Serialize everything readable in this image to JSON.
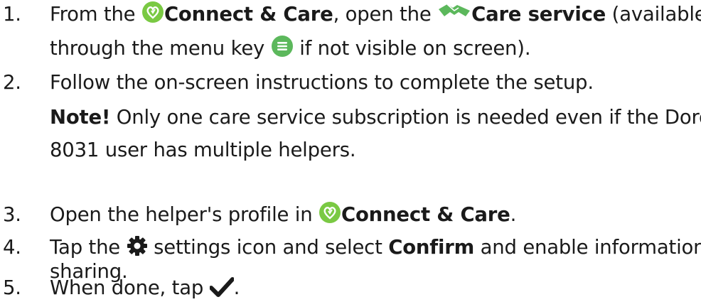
{
  "icons": {
    "connect_care": "heart-icon",
    "care_service": "handshake-icon",
    "menu": "menu-icon",
    "settings": "gear-icon",
    "done": "checkmark-icon",
    "brand_green": "#7ac943",
    "icon_green": "#5cb85c"
  },
  "steps": [
    {
      "num": "1.",
      "pre": "From the ",
      "connect_care": "Connect & Care",
      "mid": ", open the ",
      "care_service": "Care service",
      "post": " (available",
      "line2_pre": "through the menu key ",
      "line2_post": " if not visible on screen)."
    },
    {
      "num": "2.",
      "text": "Follow the on-screen instructions to complete the setup."
    },
    {
      "num": "3.",
      "pre": "Open the helper's profile in ",
      "connect_care": "Connect & Care",
      "post": "."
    },
    {
      "num": "4.",
      "pre": "Tap the ",
      "mid": " settings icon and select ",
      "confirm": "Confirm",
      "post": " and enable information",
      "line2": "sharing."
    },
    {
      "num": "5.",
      "pre": "When done, tap ",
      "post": "."
    }
  ],
  "note": {
    "label": "Note!",
    "text": " Only one care service subscription is needed even if the Doro",
    "line2": "8031 user has multiple helpers."
  }
}
